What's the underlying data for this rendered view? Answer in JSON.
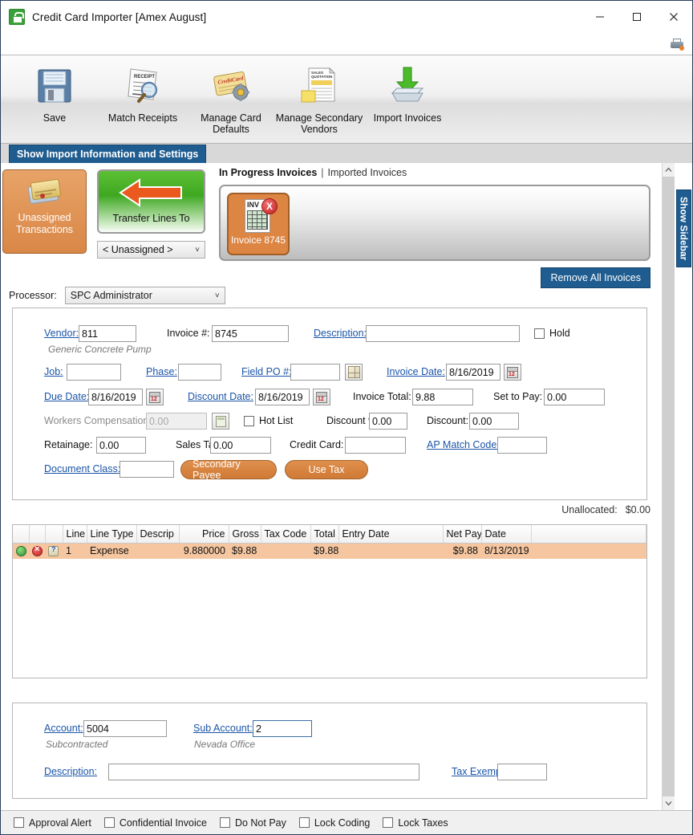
{
  "window": {
    "title": "Credit Card Importer [Amex August]",
    "icon": "credit-card-lock-icon",
    "buttons": {
      "minimize": "–",
      "maximize": "□",
      "close": "✕"
    },
    "print_icon": "printer-icon"
  },
  "toolbar": {
    "items": [
      {
        "label": "Save",
        "icon": "floppy-disk-icon"
      },
      {
        "label": "Match Receipts",
        "icon": "receipt-magnifier-icon"
      },
      {
        "label": "Manage Card Defaults",
        "icon": "credit-card-gear-icon"
      },
      {
        "label": "Manage Secondary Vendors",
        "icon": "sales-quotation-icon"
      },
      {
        "label": "Import Invoices",
        "icon": "green-down-arrow-tray-icon"
      }
    ]
  },
  "import_bar": {
    "tab_label": "Show Import Information and Settings"
  },
  "sidebar": {
    "show_label": "Show Sidebar"
  },
  "panels": {
    "unassigned": {
      "label_line1": "Unassigned",
      "label_line2": "Transactions",
      "icon": "credit-cards-icon"
    },
    "transfer": {
      "label": "Transfer Lines To",
      "icon": "left-arrow-icon"
    },
    "target_select": {
      "value": "< Unassigned >"
    },
    "tabs": {
      "active": "In Progress Invoices",
      "separator": "|",
      "inactive": "Imported Invoices"
    },
    "invoice_tile": {
      "label": "Invoice 8745",
      "doc_text": "INV",
      "badge": "X"
    },
    "remove_all_label": "Remove All Invoices"
  },
  "processor": {
    "label": "Processor:",
    "value": "SPC Administrator"
  },
  "invoice_form": {
    "vendor_label": "Vendor:",
    "vendor_value": "811",
    "vendor_name": "Generic Concrete Pump",
    "invoice_no_label": "Invoice #:",
    "invoice_no_value": "8745",
    "description_label": "Description:",
    "description_value": "",
    "hold_label": "Hold",
    "job_label": "Job:",
    "job_value": "",
    "phase_label": "Phase:",
    "phase_value": "",
    "field_po_label": "Field PO #:",
    "field_po_value": "",
    "invoice_date_label": "Invoice Date:",
    "invoice_date_value": "8/16/2019",
    "due_date_label": "Due Date:",
    "due_date_value": "8/16/2019",
    "discount_date_label": "Discount Date:",
    "discount_date_value": "8/16/2019",
    "invoice_total_label": "Invoice Total:",
    "invoice_total_value": "9.88",
    "set_to_pay_label": "Set to Pay:",
    "set_to_pay_value": "0.00",
    "workers_comp_label": "Workers Compensation:",
    "workers_comp_value": "0.00",
    "hot_list_label": "Hot List",
    "discount_pct_label": "Discount %:",
    "discount_pct_value": "0.00",
    "discount_label": "Discount:",
    "discount_value": "0.00",
    "retainage_label": "Retainage:",
    "retainage_value": "0.00",
    "sales_tax_label": "Sales Tax:",
    "sales_tax_value": "0.00",
    "credit_card_label": "Credit Card:",
    "credit_card_value": "",
    "ap_match_code_label": "AP Match Code:",
    "ap_match_code_value": "",
    "document_class_label": "Document Class:",
    "document_class_value": "",
    "secondary_payee_label": "Secondary Payee",
    "use_tax_label": "Use Tax"
  },
  "unallocated": {
    "label": "Unallocated:",
    "value": "$0.00"
  },
  "grid": {
    "columns": [
      "",
      "",
      "",
      "Line",
      "Line Type",
      "Descrip",
      "Price",
      "Gross",
      "Tax Code",
      "Total",
      "Entry Date",
      "Net Pay",
      "Date",
      ""
    ],
    "rows": [
      {
        "line": "1",
        "line_type": "Expense",
        "description": "",
        "price": "9.880000",
        "gross": "$9.88",
        "tax_code": "",
        "total": "$9.88",
        "entry_date": "",
        "net_pay": "$9.88",
        "date": "8/13/2019",
        "selected": true
      }
    ]
  },
  "account_section": {
    "account_label": "Account:",
    "account_value": "5004",
    "account_name": "Subcontracted",
    "sub_account_label": "Sub Account:",
    "sub_account_value": "2",
    "sub_account_name": "Nevada Office",
    "description_label": "Description:",
    "description_value": "",
    "tax_exempt_label": "Tax Exempt:",
    "tax_exempt_value": ""
  },
  "status_bar": {
    "checkboxes": [
      {
        "label": "Approval Alert",
        "checked": false
      },
      {
        "label": "Confidential Invoice",
        "checked": false
      },
      {
        "label": "Do Not Pay",
        "checked": false
      },
      {
        "label": "Lock Coding",
        "checked": false
      },
      {
        "label": "Lock Taxes",
        "checked": false
      }
    ]
  },
  "colors": {
    "accent_blue": "#1f5c8f",
    "orange": "#dd8644",
    "green": "#3ea821",
    "link": "#1b55a8",
    "row_selected": "#f5c6a0"
  }
}
